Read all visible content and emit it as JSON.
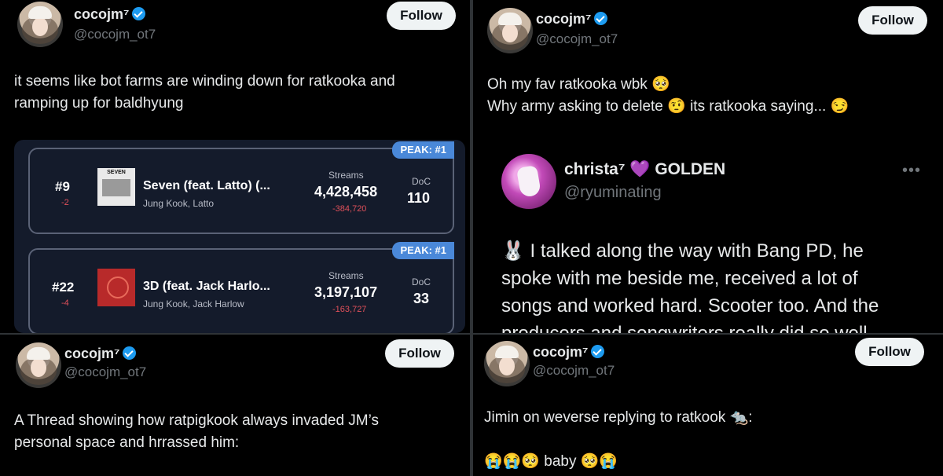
{
  "panels": [
    {
      "user": {
        "name": "cocojm⁷",
        "handle": "@cocojm_ot7",
        "verified": true
      },
      "follow_label": "Follow",
      "text_lines": [
        "it seems like bot farms are winding down  for ratkooka and",
        "ramping up for baldhyung"
      ],
      "chart_entries": [
        {
          "peak": "PEAK: #1",
          "rank": "#9",
          "change": "-2",
          "title": "Seven (feat. Latto) (...",
          "artists": "Jung Kook, Latto",
          "streams_label": "Streams",
          "streams": "4,428,458",
          "streams_change": "-384,720",
          "doc_label": "DoC",
          "doc": "110",
          "cover_text": "SEVEN"
        },
        {
          "peak": "PEAK: #1",
          "rank": "#22",
          "change": "-4",
          "title": "3D (feat. Jack Harlo...",
          "artists": "Jung Kook, Jack Harlow",
          "streams_label": "Streams",
          "streams": "3,197,107",
          "streams_change": "-163,727",
          "doc_label": "DoC",
          "doc": "33"
        }
      ]
    },
    {
      "user": {
        "name": "cocojm⁷",
        "handle": "@cocojm_ot7",
        "verified": true
      },
      "follow_label": "Follow",
      "text_lines": [
        "Oh my fav ratkooka wbk 🥺",
        "Why army asking to delete 🤨 its ratkooka saying... 😏"
      ],
      "quoted": {
        "name": "christa⁷ 💜 GOLDEN",
        "handle": "@ryuminating",
        "more": "•••",
        "lines": [
          "🐰 I talked along the way with Bang PD, he",
          "spoke with me beside me, received a lot of",
          "songs and worked hard. Scooter too. And the",
          "producers and songwriters really did so well"
        ]
      }
    },
    {
      "user": {
        "name": "cocojm⁷",
        "handle": "@cocojm_ot7",
        "verified": true
      },
      "follow_label": "Follow",
      "text_lines": [
        "A Thread showing how ratpigkook always invaded JM’s",
        "personal space and hrrassed him:"
      ]
    },
    {
      "user": {
        "name": "cocojm⁷",
        "handle": "@cocojm_ot7",
        "verified": true
      },
      "follow_label": "Follow",
      "text_lines": [
        "Jimin on weverse replying to ratkook 🐀:",
        "",
        "😭😭🥺 baby 🥺😭"
      ]
    }
  ],
  "colors": {
    "background": "#000000",
    "accent": "#1d9bf0",
    "follow_bg": "#eff3f4",
    "negative": "#e0505a",
    "peak_badge": "#4a88d8"
  },
  "icons": [
    "verified-badge-icon",
    "more-options-icon"
  ]
}
